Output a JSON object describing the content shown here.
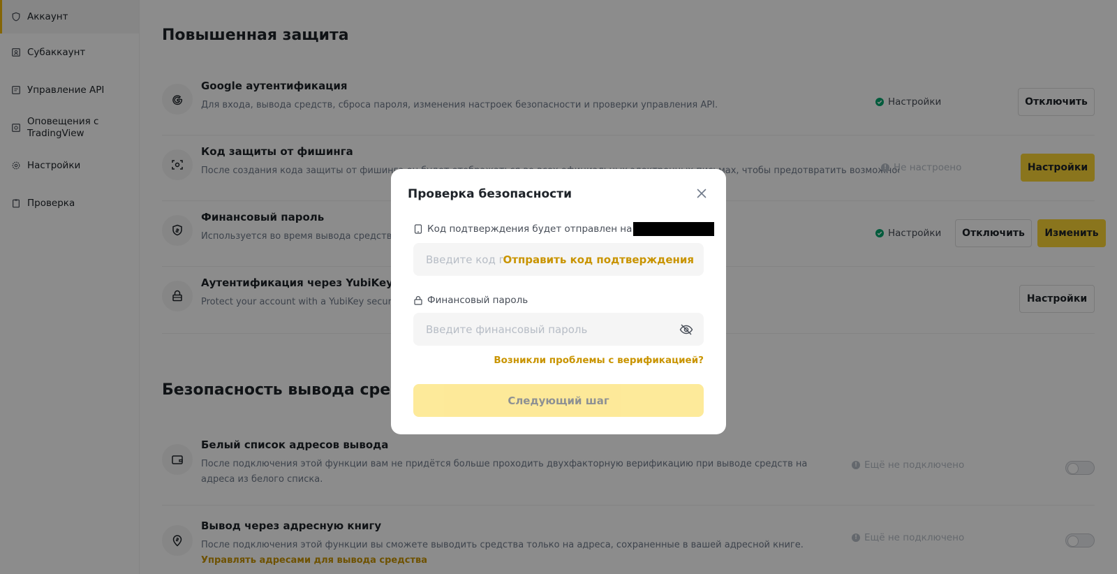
{
  "sidebar": {
    "items": [
      {
        "label": "Аккаунт"
      },
      {
        "label": "Субаккаунт"
      },
      {
        "label": "Управление API"
      },
      {
        "label": "Оповещения с TradingView"
      },
      {
        "label": "Настройки"
      },
      {
        "label": "Проверка"
      }
    ]
  },
  "enhanced": {
    "title": "Повышенная защита",
    "rows": [
      {
        "title": "Google аутентификация",
        "desc": "Для входа, вывода средств, сброса пароля, изменения настроек безопасности и проверки управления API.",
        "status": "Настройки",
        "btn1": "Отключить"
      },
      {
        "title": "Код защиты от фишинга",
        "desc": "После создания кода защиты от фишинга он будет отображаться во всех официальных электронных письмах, чтобы предотвратить возможность фишинга.",
        "status": "Не настроено",
        "btn1": "Настройки"
      },
      {
        "title": "Финансовый пароль",
        "desc": "Используется во время вывода средств, Р",
        "status": "Настройки",
        "btn1": "Отключить",
        "btn2": "Изменить"
      },
      {
        "title": "Аутентификация через YubiKey",
        "desc": "Protect your account with a YubiKey security key.",
        "btn1": "Настройки"
      }
    ]
  },
  "withdraw": {
    "title": "Безопасность вывода средств",
    "rows": [
      {
        "title": "Белый список адресов вывода",
        "desc": "После подключения этой функции вам не придётся больше проходить двухфакторную верификацию при выводе средств на адреса из белого списка.",
        "status": "Ещё не подключено"
      },
      {
        "title": "Вывод через адресную книгу",
        "desc": "После подключения этой функции вы сможете выводить средства только на адреса, сохраненные в вашей адресной книге.",
        "link": "Управлять адресами для вывода средства",
        "status": "Ещё не подключено"
      }
    ]
  },
  "modal": {
    "title": "Проверка безопасности",
    "code_label": "Код подтверждения будет отправлен на",
    "code_placeholder": "Введите код подтверждения",
    "send_code": "Отправить код подтверждения",
    "password_label": "Финансовый пароль",
    "password_placeholder": "Введите финансовый пароль",
    "help_link": "Возникли проблемы с верификацией?",
    "next_button": "Следующий шаг"
  },
  "colors": {
    "accent": "#FCD535",
    "link": "#C99400",
    "success": "#03A66D",
    "muted": "#B7BDC6"
  }
}
